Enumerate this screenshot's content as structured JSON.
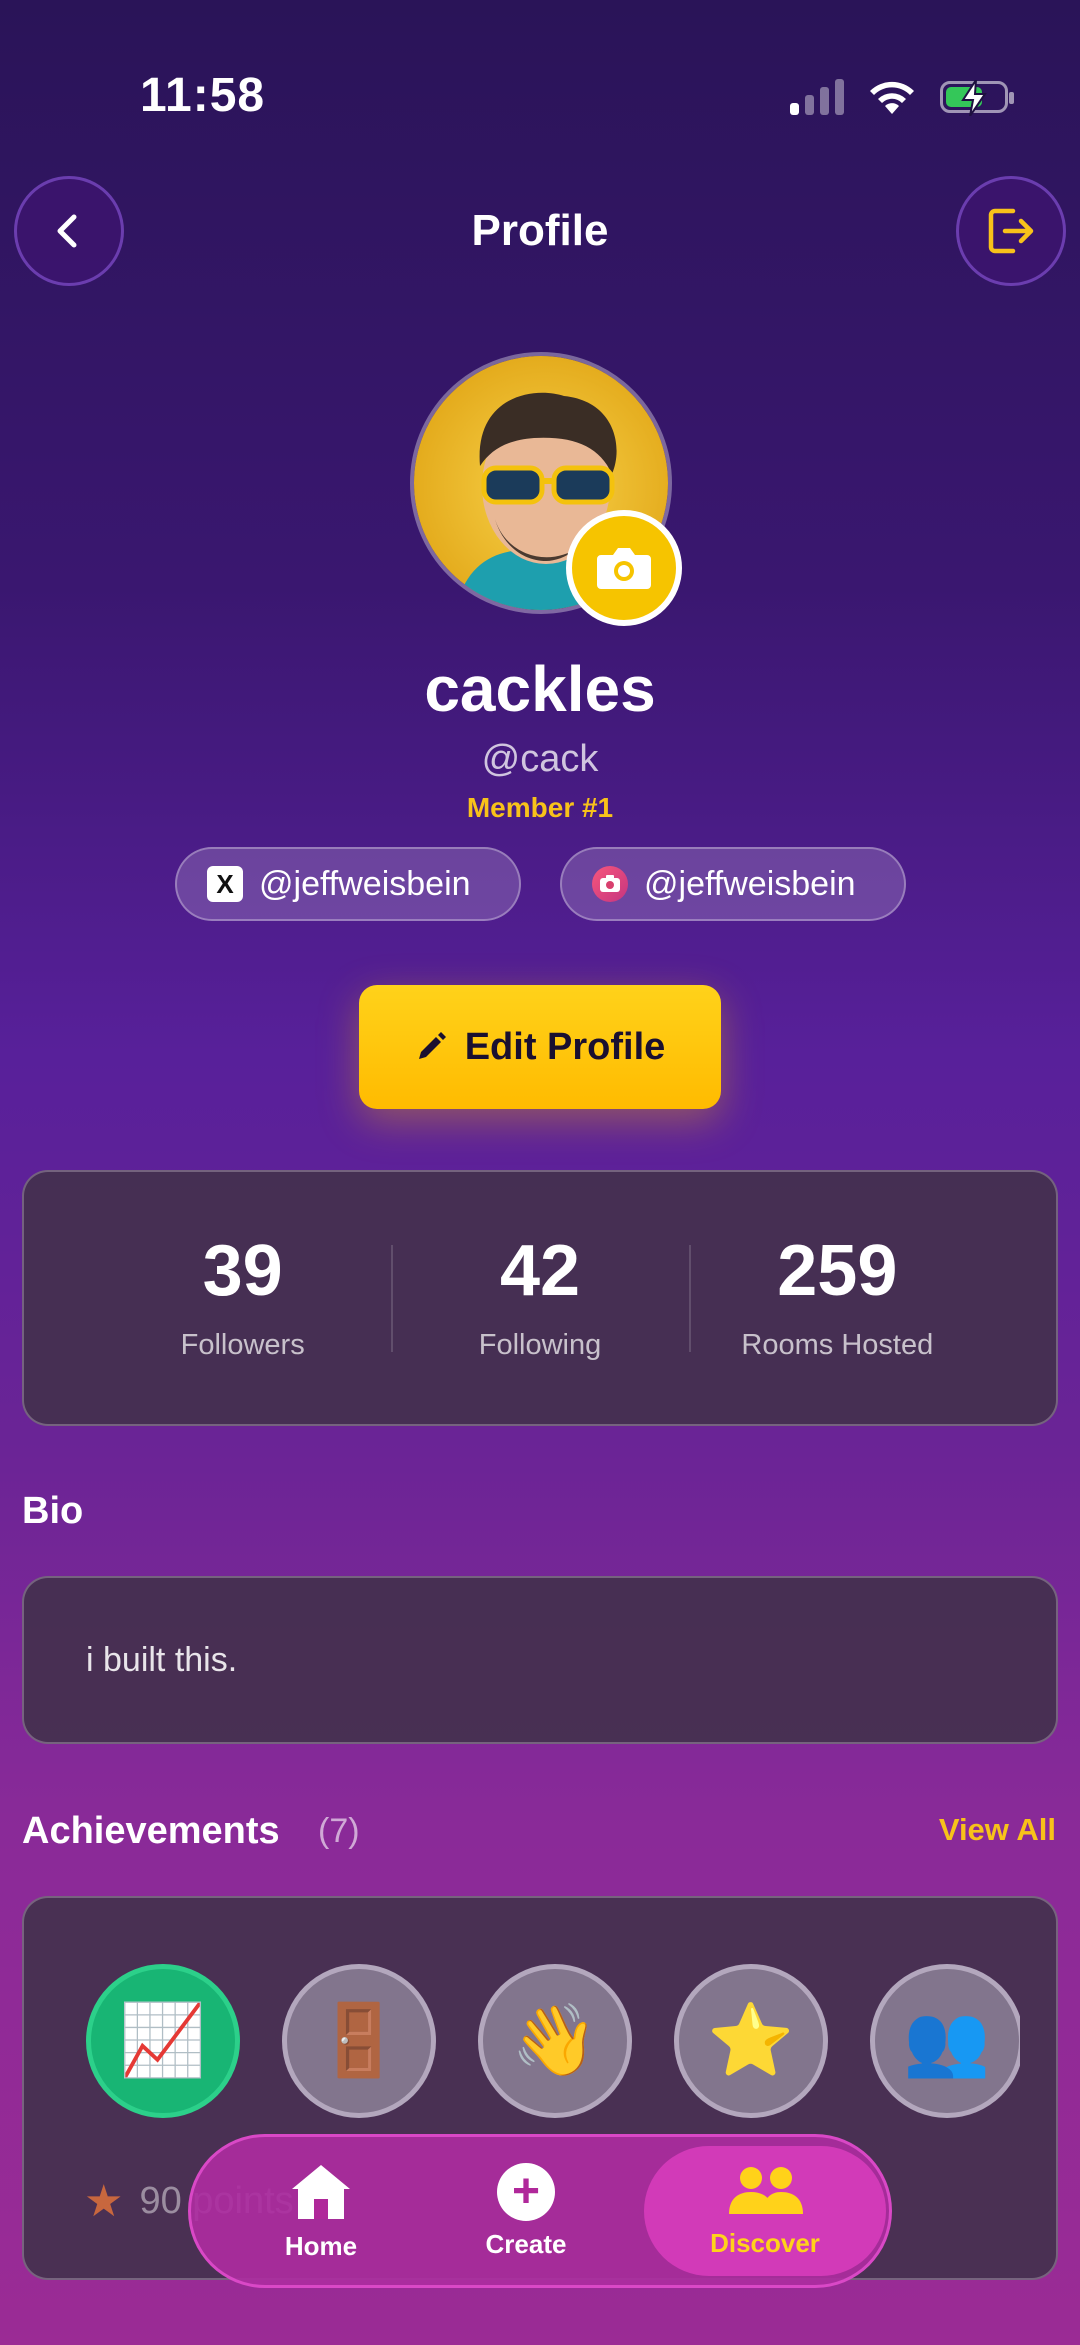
{
  "status_bar": {
    "time": "11:58"
  },
  "header": {
    "title": "Profile"
  },
  "profile": {
    "display_name": "cackles",
    "handle": "@cack",
    "member_badge": "Member #1",
    "x_handle": "@jeffweisbein",
    "instagram_handle": "@jeffweisbein",
    "x_icon_letter": "X"
  },
  "edit_button": {
    "label": "Edit Profile"
  },
  "stats": [
    {
      "value": "39",
      "label": "Followers"
    },
    {
      "value": "42",
      "label": "Following"
    },
    {
      "value": "259",
      "label": "Rooms Hosted"
    }
  ],
  "bio": {
    "title": "Bio",
    "text": "i built this."
  },
  "achievements": {
    "title": "Achievements",
    "count": "(7)",
    "view_all": "View All",
    "badges": [
      {
        "emoji": "📈",
        "earned": true
      },
      {
        "emoji": "🚪",
        "earned": false
      },
      {
        "emoji": "👋",
        "earned": false
      },
      {
        "emoji": "⭐",
        "earned": false
      },
      {
        "emoji": "👥",
        "earned": false
      }
    ],
    "points_text": "90 points"
  },
  "nav": {
    "home": "Home",
    "create": "Create",
    "discover": "Discover",
    "active": "Discover"
  },
  "colors": {
    "accent": "#f8c21a",
    "badge_earned": "#18b574"
  }
}
